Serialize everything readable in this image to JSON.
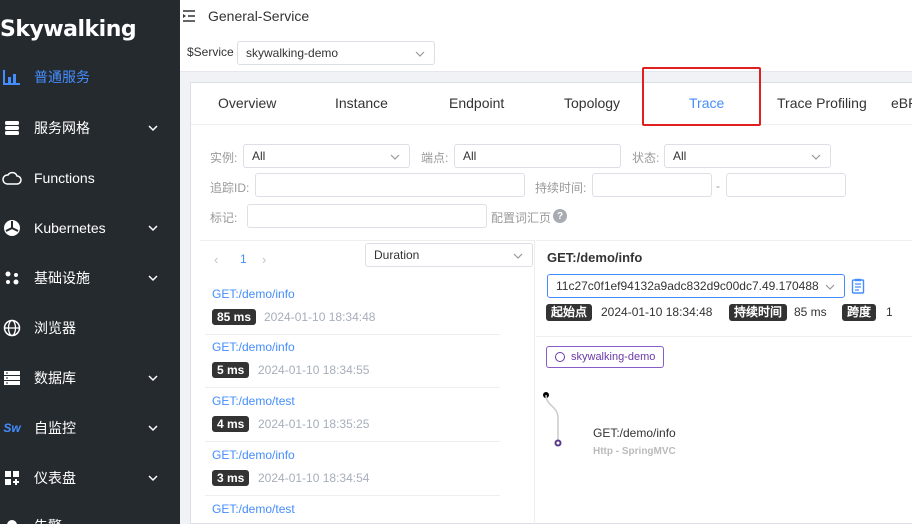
{
  "app": {
    "logo": "Skywalking"
  },
  "sidebar": {
    "items": [
      {
        "label": "普通服务",
        "icon": "chart-icon",
        "active": true,
        "has_chevron": false
      },
      {
        "label": "服务网格",
        "icon": "mesh-icon",
        "active": false,
        "has_chevron": true
      },
      {
        "label": "Functions",
        "icon": "cloud-icon",
        "active": false,
        "has_chevron": false
      },
      {
        "label": "Kubernetes",
        "icon": "kubernetes-icon",
        "active": false,
        "has_chevron": true
      },
      {
        "label": "基础设施",
        "icon": "infra-icon",
        "active": false,
        "has_chevron": true
      },
      {
        "label": "浏览器",
        "icon": "globe-icon",
        "active": false,
        "has_chevron": false
      },
      {
        "label": "数据库",
        "icon": "database-icon",
        "active": false,
        "has_chevron": true
      },
      {
        "label": "自监控",
        "icon": "sw-icon",
        "active": false,
        "has_chevron": true
      },
      {
        "label": "仪表盘",
        "icon": "dashboard-icon",
        "active": false,
        "has_chevron": true
      },
      {
        "label": "告警",
        "icon": "alarm-icon",
        "active": false,
        "has_chevron": false
      }
    ]
  },
  "header": {
    "title": "General-Service",
    "service_label": "$Service",
    "service_value": "skywalking-demo"
  },
  "tabs": [
    {
      "label": "Overview",
      "active": false
    },
    {
      "label": "Instance",
      "active": false
    },
    {
      "label": "Endpoint",
      "active": false
    },
    {
      "label": "Topology",
      "active": false
    },
    {
      "label": "Trace",
      "active": true
    },
    {
      "label": "Trace Profiling",
      "active": false
    },
    {
      "label": "eBPF",
      "active": false
    }
  ],
  "filters": {
    "instance_label": "实例:",
    "instance_value": "All",
    "endpoint_label": "端点:",
    "endpoint_value": "All",
    "status_label": "状态:",
    "status_value": "All",
    "trace_id_label": "追踪ID:",
    "trace_id_value": "",
    "duration_label": "持续时间:",
    "duration_min": "",
    "duration_sep": "-",
    "duration_max": "",
    "tags_label": "标记:",
    "tags_value": "",
    "config_label": "配置词汇页",
    "help_glyph": "?"
  },
  "list": {
    "page": "1",
    "prev_glyph": "‹",
    "next_glyph": "›",
    "sort_value": "Duration",
    "items": [
      {
        "endpoint": "GET:/demo/info",
        "duration": "85 ms",
        "time": "2024-01-10 18:34:48"
      },
      {
        "endpoint": "GET:/demo/info",
        "duration": "5 ms",
        "time": "2024-01-10 18:34:55"
      },
      {
        "endpoint": "GET:/demo/test",
        "duration": "4 ms",
        "time": "2024-01-10 18:35:25"
      },
      {
        "endpoint": "GET:/demo/info",
        "duration": "3 ms",
        "time": "2024-01-10 18:34:54"
      },
      {
        "endpoint": "GET:/demo/test",
        "duration": "",
        "time": ""
      }
    ]
  },
  "detail": {
    "title": "GET:/demo/info",
    "trace_id": "11c27c0f1ef94132a9adc832d9c00dc7.49.170488",
    "start_label": "起始点",
    "start_value": "2024-01-10 18:34:48",
    "duration_label": "持续时间",
    "duration_value": "85 ms",
    "span_label": "跨度",
    "span_value": "1",
    "service_tag": "skywalking-demo",
    "span_name": "GET:/demo/info",
    "span_sub": "Http - SpringMVC"
  },
  "colors": {
    "sidebar_bg": "#252a2f",
    "accent": "#448dfe",
    "highlight": "#e02020",
    "service_tag": "#6a3aa6"
  }
}
